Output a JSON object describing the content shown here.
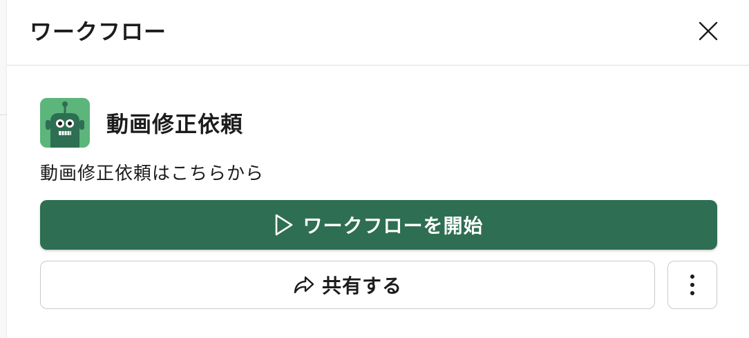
{
  "header": {
    "title": "ワークフロー",
    "close_icon": "close-icon"
  },
  "workflow": {
    "app_icon": "robot-icon",
    "name": "動画修正依頼",
    "description": "動画修正依頼はこちらから"
  },
  "actions": {
    "start_label": "ワークフローを開始",
    "start_icon": "play-icon",
    "share_label": "共有する",
    "share_icon": "share-arrow-icon",
    "more_icon": "more-vertical-icon"
  },
  "colors": {
    "primary_button": "#2e6e52",
    "app_icon_bg": "#5cb57b",
    "robot_body": "#2e6e52"
  }
}
